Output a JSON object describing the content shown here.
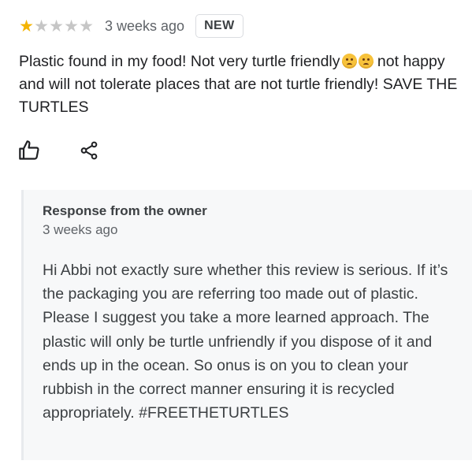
{
  "review": {
    "rating": 1,
    "rating_max": 5,
    "star_filled_color": "#f4b400",
    "star_empty_color": "#c6c6c6",
    "time_ago": "3 weeks ago",
    "badge": "NEW",
    "text_part1": "Plastic found in my food! Not very turtle friendly",
    "emoji_icons": [
      "angry-face-icon",
      "angry-face-icon"
    ],
    "text_part2": " not happy and will not tolerate places that are not turtle friendly! SAVE THE TURTLES"
  },
  "actions": {
    "icons": [
      "thumbs-up-icon",
      "share-icon"
    ]
  },
  "owner_response": {
    "title": "Response from the owner",
    "time_ago": "3 weeks ago",
    "text": "Hi Abbi not exactly sure whether this review is serious. If it’s the packaging you are referring too made out of plastic. Please I suggest you take a more learned approach. The plastic will only be turtle unfriendly if you dispose of it and ends up in the ocean. So onus is on you to clean your rubbish in the correct manner ensuring it is recycled appropriately. #FREETHETURTLES"
  }
}
